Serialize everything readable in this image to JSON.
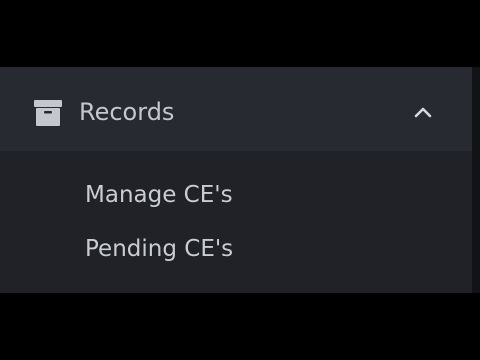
{
  "sidebar": {
    "section": {
      "label": "Records",
      "icon": "archive-box-icon",
      "state": "expanded",
      "chevron_icon": "chevron-up-icon"
    },
    "items": [
      {
        "label": "Manage CE's"
      },
      {
        "label": "Pending CE's"
      }
    ]
  },
  "colors": {
    "header_bg": "#272a31",
    "submenu_bg": "#202227",
    "text": "#c9ccd1",
    "frame": "#000000"
  }
}
